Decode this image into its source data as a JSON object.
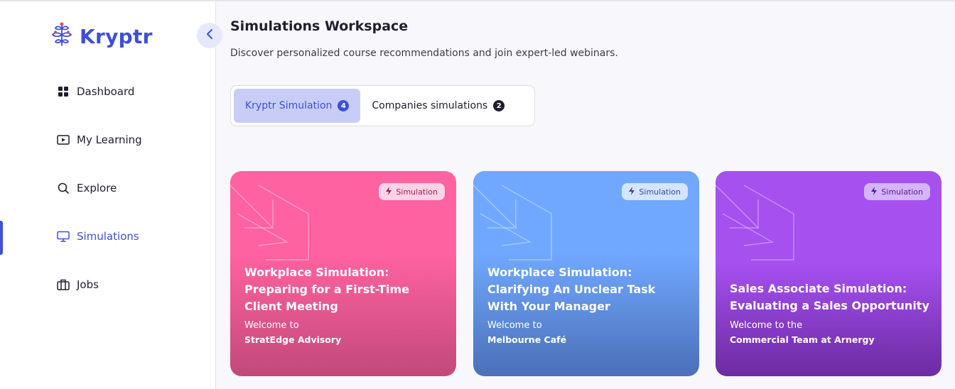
{
  "app": {
    "brand": "Kryptr"
  },
  "sidebar": {
    "items": [
      {
        "label": "Dashboard",
        "icon": "dashboard-grid-icon"
      },
      {
        "label": "My Learning",
        "icon": "video-play-icon"
      },
      {
        "label": "Explore",
        "icon": "search-icon"
      },
      {
        "label": "Simulations",
        "icon": "monitor-icon",
        "active": true
      },
      {
        "label": "Jobs",
        "icon": "briefcase-icon"
      }
    ]
  },
  "header": {
    "title": "Simulations Workspace",
    "subtitle": "Discover personalized course recommendations and join expert-led webinars."
  },
  "tabs": [
    {
      "label": "Kryptr Simulation",
      "count": "4",
      "active": true
    },
    {
      "label": "Companies simulations",
      "count": "2",
      "active": false
    }
  ],
  "cards": [
    {
      "badge": "Simulation",
      "title": "Workplace Simulation: Preparing for a First-Time Client Meeting",
      "welcome": "Welcome to",
      "company": "StratEdge Advisory",
      "color_top": "#ff5f9e",
      "color_bottom": "#c04878",
      "badge_bg": "#ffd3e6",
      "badge_fg": "#a0205a"
    },
    {
      "badge": "Simulation",
      "title": "Workplace Simulation: Clarifying An Unclear Task With Your Manager",
      "welcome": "Welcome to",
      "company": "Melbourne Café",
      "color_top": "#6fa7ff",
      "color_bottom": "#4a6fb8",
      "badge_bg": "#d6e4ff",
      "badge_fg": "#2a4f9a"
    },
    {
      "badge": "Simulation",
      "title": "Sales Associate Simulation: Evaluating a Sales Opportunity",
      "welcome": "Welcome to the",
      "company": "Commercial Team at Arnergy",
      "color_top": "#a64ff0",
      "color_bottom": "#6a2aa0",
      "badge_bg": "#d4b4fa",
      "badge_fg": "#5a1a90"
    }
  ]
}
